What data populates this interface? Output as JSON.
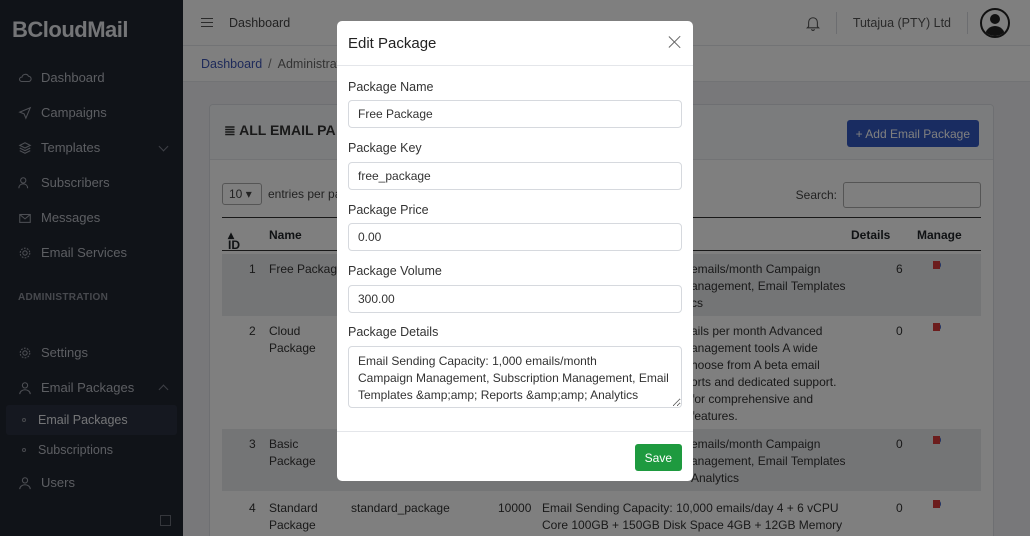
{
  "app": {
    "brand": "BCloudMail"
  },
  "sidebar": {
    "items": [
      {
        "label": "Dashboard",
        "icon": "cloud-icon"
      },
      {
        "label": "Campaigns",
        "icon": "send-icon"
      },
      {
        "label": "Templates",
        "icon": "layers-icon"
      },
      {
        "label": "Subscribers",
        "icon": "users-icon"
      },
      {
        "label": "Messages",
        "icon": "envelope-icon"
      },
      {
        "label": "Email Services",
        "icon": "gear-icon"
      }
    ],
    "section_title": "ADMINISTRATION",
    "admin_items": [
      {
        "label": "Settings",
        "icon": "gear-icon"
      },
      {
        "label": "Email Packages",
        "icon": "user-icon"
      }
    ],
    "sub_items": [
      {
        "label": "Email Packages",
        "active": true
      },
      {
        "label": "Subscriptions",
        "active": false
      }
    ],
    "users_label": "Users"
  },
  "header": {
    "title": "Dashboard",
    "company": "Tutajua (PTY) Ltd"
  },
  "breadcrumb": {
    "root": "Dashboard",
    "current": "Administratio"
  },
  "card": {
    "title": "ALL EMAIL PA",
    "add_button": "+ Add Email Package",
    "page_length": "10",
    "entries_label": "entries per pa",
    "search_label": "Search:",
    "columns": {
      "id": "ID",
      "name": "Name",
      "details": "Details",
      "manage": "Manage"
    },
    "rows": [
      {
        "id": "1",
        "name": "Free Package",
        "name2": "",
        "key": "",
        "volume": "",
        "desc1": "emails/month Campaign",
        "desc2": "anagement, Email Templates",
        "desc3": "cs",
        "desc4": "",
        "desc5": "",
        "details": "6"
      },
      {
        "id": "2",
        "name": "Cloud",
        "name2": "Package",
        "key": "",
        "volume": "",
        "desc1": "ails per month Advanced",
        "desc2": "anagement tools A wide",
        "desc3": "hoose from A beta email",
        "desc4": "orts and dedicated support.",
        "desc5": "for comprehensive and",
        "desc6": "features.",
        "details": "0"
      },
      {
        "id": "3",
        "name": "Basic",
        "name2": "Package",
        "key": "",
        "volume": "",
        "desc1": "emails/month Campaign",
        "desc2": "anagement, Email Templates",
        "desc3": "Analytics",
        "desc3_prefix": "&amp;amp; Reports &amp;amp;",
        "details": "0"
      },
      {
        "id": "4",
        "name": "Standard",
        "name2": "Package",
        "key": "standard_package",
        "volume": "10000",
        "desc1": "Email Sending Capacity: 10,000 emails/day 4 + 6 vCPU",
        "desc2": "Core 100GB + 150GB Disk Space 4GB + 12GB Memory",
        "details": "0"
      }
    ]
  },
  "modal": {
    "title": "Edit Package",
    "fields": {
      "name_label": "Package Name",
      "name_value": "Free Package",
      "key_label": "Package Key",
      "key_value": "free_package",
      "price_label": "Package Price",
      "price_value": "0.00",
      "volume_label": "Package Volume",
      "volume_value": "300.00",
      "details_label": "Package Details",
      "details_line1": "Email Sending Capacity: 1,000 emails/month",
      "details_line2": "Campaign Management, Subscription Management, Email",
      "details_line3": "Templates &amp;amp; Reports &amp;amp; Analytics"
    },
    "save_label": "Save"
  }
}
